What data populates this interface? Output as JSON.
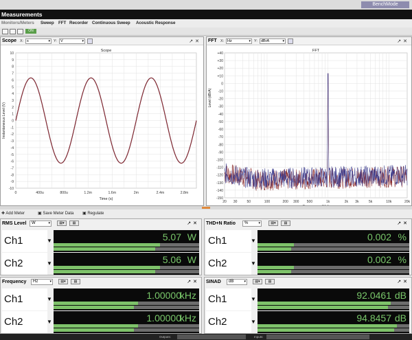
{
  "top_bar": {
    "benchmode_label": "BenchMode"
  },
  "window": {
    "title": "Measurements"
  },
  "menu": [
    {
      "label": "Monitors/Meters"
    },
    {
      "label": "Sweep"
    },
    {
      "label": "FFT"
    },
    {
      "label": "Recorder"
    },
    {
      "label": "Continuous Sweep"
    },
    {
      "label": "Acoustic Response"
    }
  ],
  "toolbar": {
    "on_label": "ON"
  },
  "scope": {
    "panel_title": "Scope",
    "x_axis_label": "X:",
    "x_select": "s",
    "y_axis_label": "Y:",
    "y_select": "V",
    "chart_data": {
      "type": "line",
      "title": "Scope",
      "xlabel": "Time (s)",
      "ylabel": "Instantaneous Level (V)",
      "xlim": [
        0,
        0.003
      ],
      "ylim": [
        -10,
        10
      ],
      "x_ticks": [
        {
          "v": 0,
          "label": "0"
        },
        {
          "v": 0.0004,
          "label": "400u"
        },
        {
          "v": 0.0008,
          "label": "800u"
        },
        {
          "v": 0.0012,
          "label": "1.2m"
        },
        {
          "v": 0.0016,
          "label": "1.6m"
        },
        {
          "v": 0.002,
          "label": "2m"
        },
        {
          "v": 0.0024,
          "label": "2.4m"
        },
        {
          "v": 0.0028,
          "label": "2.8m"
        }
      ],
      "y_ticks": [
        10,
        9,
        8,
        7,
        6,
        5,
        4,
        3,
        2,
        1,
        0,
        -1,
        -2,
        -3,
        -4,
        -5,
        -6,
        -7,
        -8,
        -9,
        -10
      ],
      "series": [
        {
          "amplitude": 6.3,
          "frequency_hz": 1000,
          "color": "#8b2c2c"
        },
        {
          "amplitude": 6.3,
          "frequency_hz": 1000,
          "color": "#3a3a8c"
        }
      ],
      "grid": true
    }
  },
  "fft": {
    "panel_title": "FFT",
    "x_axis_label": "X:",
    "x_select": "Hz",
    "y_axis_label": "Y:",
    "y_select": "dBrA",
    "chart_data": {
      "type": "line",
      "title": "FFT",
      "xlabel": "Frequency (Hz)",
      "ylabel": "Level (dBrA)",
      "x_scale": "log",
      "xlim": [
        20,
        20000
      ],
      "ylim": [
        -150,
        40
      ],
      "x_ticks": [
        {
          "v": 20,
          "label": "20"
        },
        {
          "v": 30,
          "label": "30"
        },
        {
          "v": 50,
          "label": "50"
        },
        {
          "v": 100,
          "label": "100"
        },
        {
          "v": 200,
          "label": "200"
        },
        {
          "v": 300,
          "label": "300"
        },
        {
          "v": 500,
          "label": "500"
        },
        {
          "v": 1000,
          "label": "1k"
        },
        {
          "v": 2000,
          "label": "2k"
        },
        {
          "v": 3000,
          "label": "3k"
        },
        {
          "v": 5000,
          "label": "5k"
        },
        {
          "v": 10000,
          "label": "10k"
        },
        {
          "v": 20000,
          "label": "20k"
        }
      ],
      "y_ticks": [
        "+40",
        "+30",
        "+20",
        "+10",
        "0",
        "-10",
        "-20",
        "-30",
        "-40",
        "-50",
        "-60",
        "-70",
        "-80",
        "-90",
        "-100",
        "-110",
        "-120",
        "-130",
        "-140",
        "-150"
      ],
      "peak": {
        "frequency_hz": 1000,
        "level": 13
      },
      "noise_floor": {
        "low": -145,
        "high": -105
      },
      "series": [
        {
          "color": "#8b2c2c"
        },
        {
          "color": "#3a3a8c"
        }
      ],
      "grid": true
    }
  },
  "meter_bar": {
    "add_meter": "Add Meter",
    "save_meter_data": "Save Meter Data",
    "regulate": "Regulate"
  },
  "meters": {
    "rms": {
      "title": "RMS Level",
      "unit_select": "W",
      "rows": [
        {
          "channel": "Ch1",
          "value": "5.07",
          "unit": "W",
          "bar": [
            0.73,
            0.7
          ]
        },
        {
          "channel": "Ch2",
          "value": "5.06",
          "unit": "W",
          "bar": [
            0.73,
            0.7
          ]
        }
      ]
    },
    "thdn": {
      "title": "THD+N Ratio",
      "unit_select": "%",
      "rows": [
        {
          "channel": "Ch1",
          "value": "0.002",
          "unit": "%",
          "bar": [
            0.24,
            0.22
          ]
        },
        {
          "channel": "Ch2",
          "value": "0.002",
          "unit": "%",
          "bar": [
            0.24,
            0.22
          ]
        }
      ]
    },
    "frequency": {
      "title": "Frequency",
      "unit_select": "Hz",
      "rows": [
        {
          "channel": "Ch1",
          "value": "1.00000",
          "unit": "kHz",
          "bar": [
            0.58,
            0.55
          ]
        },
        {
          "channel": "Ch2",
          "value": "1.00000",
          "unit": "kHz",
          "bar": [
            0.58,
            0.55
          ]
        }
      ]
    },
    "sinad": {
      "title": "SINAD",
      "unit_select": "dB",
      "rows": [
        {
          "channel": "Ch1",
          "value": "92.0461",
          "unit": "dB",
          "bar": [
            0.88,
            0.86
          ]
        },
        {
          "channel": "Ch2",
          "value": "94.8457",
          "unit": "dB",
          "bar": [
            0.92,
            0.9
          ]
        }
      ]
    }
  },
  "status_bar": {
    "outputs_label": "Outputs:",
    "inputs_label": "Inputs:"
  },
  "colors": {
    "meter_text": "#79c76a",
    "meter_bar": "#7ec26a",
    "trace_red": "#8b2c2c",
    "trace_blue": "#3a3a8c"
  }
}
